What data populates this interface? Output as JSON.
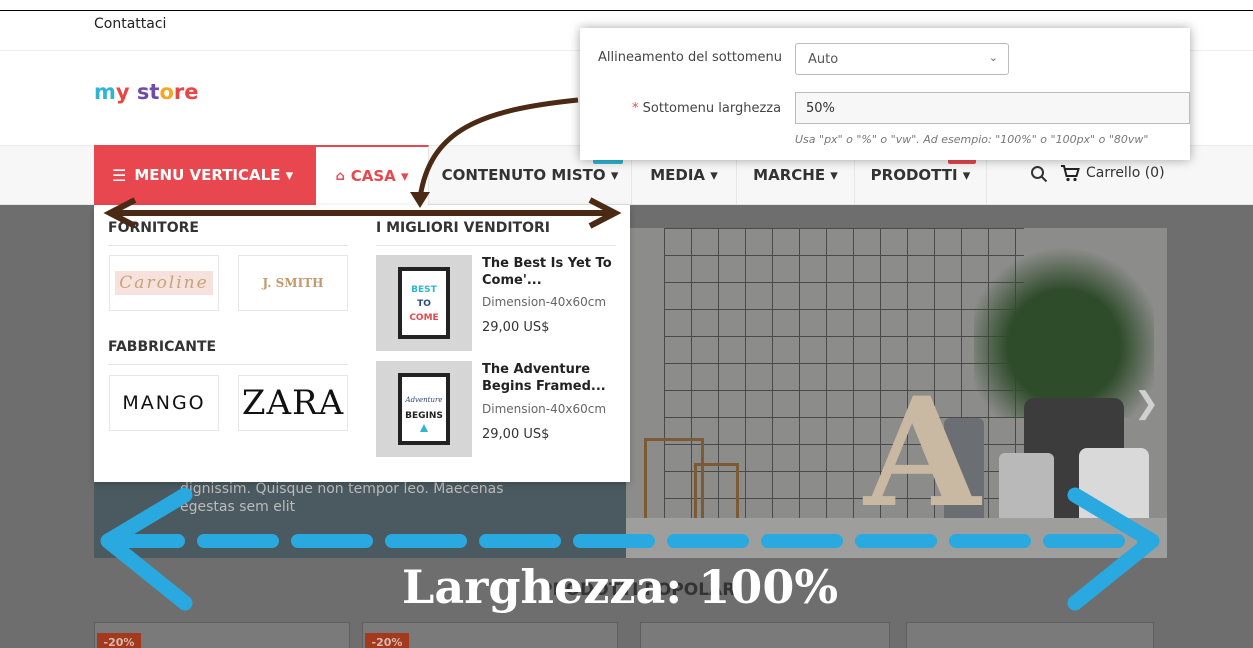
{
  "topbar": {
    "contact": "Contattaci"
  },
  "logo": {
    "text": "my store"
  },
  "nav": {
    "vertical_menu": "MENU VERTICALE ▾",
    "items": [
      {
        "label": "CASA ▾",
        "icon": "home-icon"
      },
      {
        "label": "CONTENUTO MISTO ▾"
      },
      {
        "label": "MEDIA ▾"
      },
      {
        "label": "MARCHE ▾"
      },
      {
        "label": "PRODOTTI ▾"
      }
    ],
    "cart": "Carrello (0)"
  },
  "mega_menu": {
    "supplier_title": "FORNITORE",
    "supplier_brands": [
      "Caroline",
      "J. SMITH"
    ],
    "manufacturer_title": "FABBRICANTE",
    "manufacturer_brands": [
      "MANGO",
      "ZARA"
    ],
    "bestsellers_title": "I MIGLIORI VENDITORI",
    "products": [
      {
        "name": "The Best Is Yet To Come'...",
        "dimension": "Dimension-40x60cm",
        "price": "29,00 US$"
      },
      {
        "name": "The Adventure Begins Framed...",
        "dimension": "Dimension-40x60cm",
        "price": "29,00 US$"
      }
    ]
  },
  "slider": {
    "text": "dignissim. Quisque non tempor leo. Maecenas egestas sem elit"
  },
  "products_section": {
    "title": "PRODOTTI POPOLARI",
    "badges": [
      "-20%",
      "-20%"
    ]
  },
  "settings_panel": {
    "align_label": "Allineamento del sottomenu",
    "align_value": "Auto",
    "width_required": "*",
    "width_label": "Sottomenu larghezza",
    "width_value": "50%",
    "width_help": "Usa \"px\" o \"%\" o \"vw\". Ad esempio: \"100%\" o \"100px\" o \"80vw\""
  },
  "annotation": {
    "text": "Larghezza: 100%"
  },
  "colors": {
    "accent": "#e9474f",
    "annotation_arrow": "#29a9e0",
    "brown_arrow": "#4a2a14"
  }
}
